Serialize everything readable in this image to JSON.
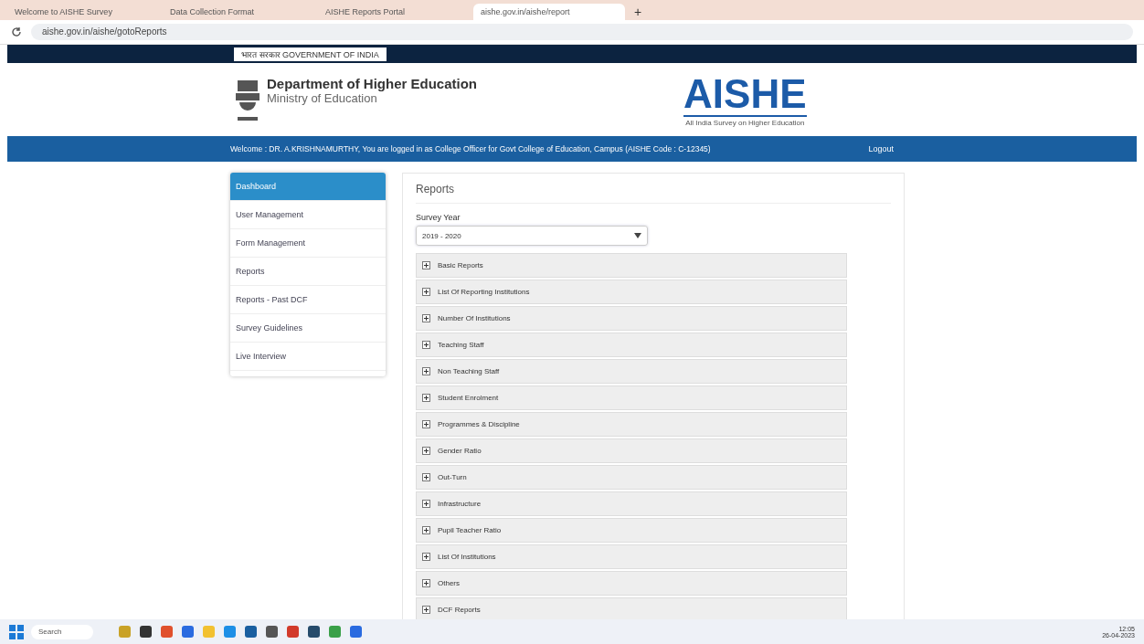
{
  "browser": {
    "tabs": [
      {
        "title": "Welcome to AISHE Survey",
        "selected": false
      },
      {
        "title": "Data Collection Format",
        "selected": false
      },
      {
        "title": "AISHE Reports Portal",
        "selected": false
      },
      {
        "title": "aishe.gov.in/aishe/report",
        "selected": true
      }
    ],
    "new_tab": "+",
    "url": "aishe.gov.in/aishe/gotoReports"
  },
  "gov_bar": {
    "text": "भारत सरकार GOVERNMENT OF INDIA"
  },
  "header": {
    "department": "Department of Higher Education",
    "ministry": "Ministry of Education",
    "logo": "AISHE",
    "logo_tagline": "All India Survey on Higher Education"
  },
  "welcome_bar": {
    "text": "Welcome : DR. A.KRISHNAMURTHY, You are logged in as College Officer for Govt College of Education, Campus (AISHE Code : C-12345)",
    "user": "Logout"
  },
  "sidebar": {
    "items": [
      {
        "label": "Dashboard",
        "selected": true
      },
      {
        "label": "User Management",
        "selected": false
      },
      {
        "label": "Form Management",
        "selected": false
      },
      {
        "label": "Reports",
        "selected": false
      },
      {
        "label": "Reports - Past DCF",
        "selected": false
      },
      {
        "label": "Survey Guidelines",
        "selected": false
      },
      {
        "label": "Live Interview",
        "selected": false
      }
    ]
  },
  "main": {
    "title": "Reports",
    "survey_year_label": "Survey Year",
    "survey_year": "2019 - 2020",
    "sections": [
      {
        "label": "Basic Reports",
        "expanded": false
      },
      {
        "label": "List Of Reporting Institutions",
        "expanded": false
      },
      {
        "label": "Number Of Institutions",
        "expanded": false
      },
      {
        "label": "Teaching Staff",
        "expanded": false
      },
      {
        "label": "Non Teaching Staff",
        "expanded": false
      },
      {
        "label": "Student Enrolment",
        "expanded": false
      },
      {
        "label": "Programmes & Discipline",
        "expanded": false
      },
      {
        "label": "Gender Ratio",
        "expanded": false
      },
      {
        "label": "Out-Turn",
        "expanded": false
      },
      {
        "label": "Infrastructure",
        "expanded": false
      },
      {
        "label": "Pupil Teacher Ratio",
        "expanded": false
      },
      {
        "label": "List Of Institutions",
        "expanded": false
      },
      {
        "label": "Others",
        "expanded": false
      },
      {
        "label": "DCF Reports",
        "expanded": false
      }
    ]
  },
  "taskbar": {
    "search": "Search",
    "time": "12:05",
    "date": "26-04-2023"
  }
}
